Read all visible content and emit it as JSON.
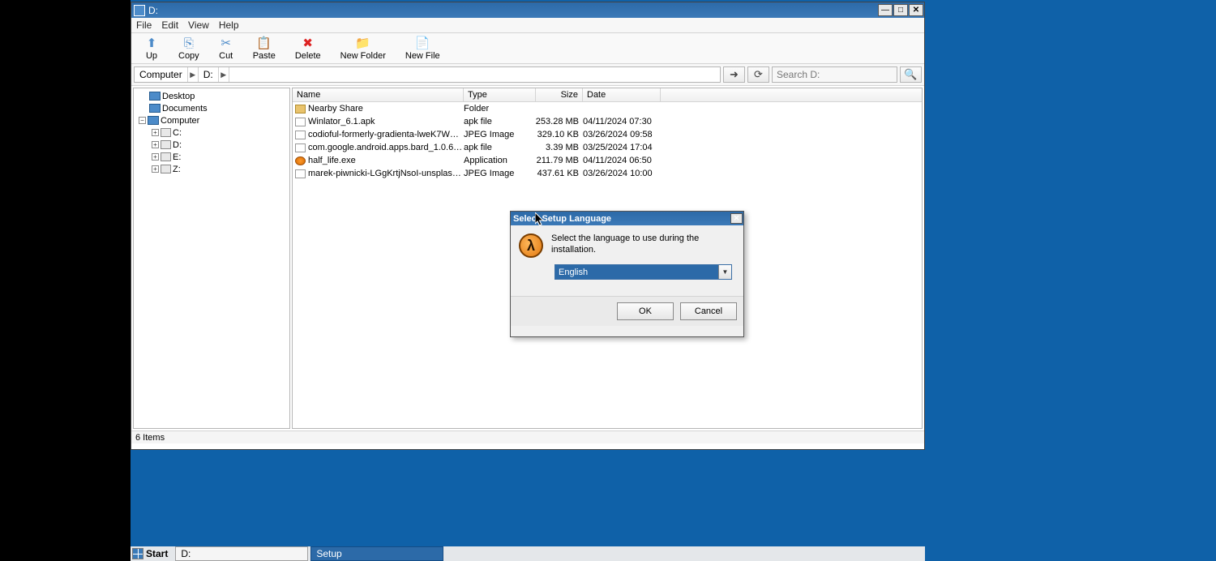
{
  "window": {
    "title": "D:",
    "menu": {
      "file": "File",
      "edit": "Edit",
      "view": "View",
      "help": "Help"
    },
    "toolbar": {
      "up": "Up",
      "copy": "Copy",
      "cut": "Cut",
      "paste": "Paste",
      "delete": "Delete",
      "newfolder": "New Folder",
      "newfile": "New File"
    },
    "breadcrumb": {
      "computer": "Computer",
      "drive": "D:"
    },
    "search_placeholder": "Search D:",
    "columns": {
      "name": "Name",
      "type": "Type",
      "size": "Size",
      "date": "Date"
    },
    "tree": {
      "desktop": "Desktop",
      "documents": "Documents",
      "computer": "Computer",
      "drives": {
        "c": "C:",
        "d": "D:",
        "e": "E:",
        "z": "Z:"
      }
    },
    "files": [
      {
        "name": "Nearby Share",
        "type": "Folder",
        "size": "",
        "date": ""
      },
      {
        "name": "Winlator_6.1.apk",
        "type": "apk file",
        "size": "253.28 MB",
        "date": "04/11/2024 07:30"
      },
      {
        "name": "codioful-formerly-gradienta-lweK7W…",
        "type": "JPEG Image",
        "size": "329.10 KB",
        "date": "03/26/2024 09:58"
      },
      {
        "name": "com.google.android.apps.bard_1.0.6…",
        "type": "apk file",
        "size": "3.39 MB",
        "date": "03/25/2024 17:04"
      },
      {
        "name": "half_life.exe",
        "type": "Application",
        "size": "211.79 MB",
        "date": "04/11/2024 06:50"
      },
      {
        "name": "marek-piwnicki-LGgKrtjNsoI-unsplas…",
        "type": "JPEG Image",
        "size": "437.61 KB",
        "date": "03/26/2024 10:00"
      }
    ],
    "status": "6 Items"
  },
  "dialog": {
    "title": "Select Setup Language",
    "message": "Select the language to use during the installation.",
    "selected": "English",
    "ok": "OK",
    "cancel": "Cancel"
  },
  "taskbar": {
    "start": "Start",
    "items": [
      {
        "label": "D:",
        "active": false
      },
      {
        "label": "Setup",
        "active": true
      }
    ]
  }
}
